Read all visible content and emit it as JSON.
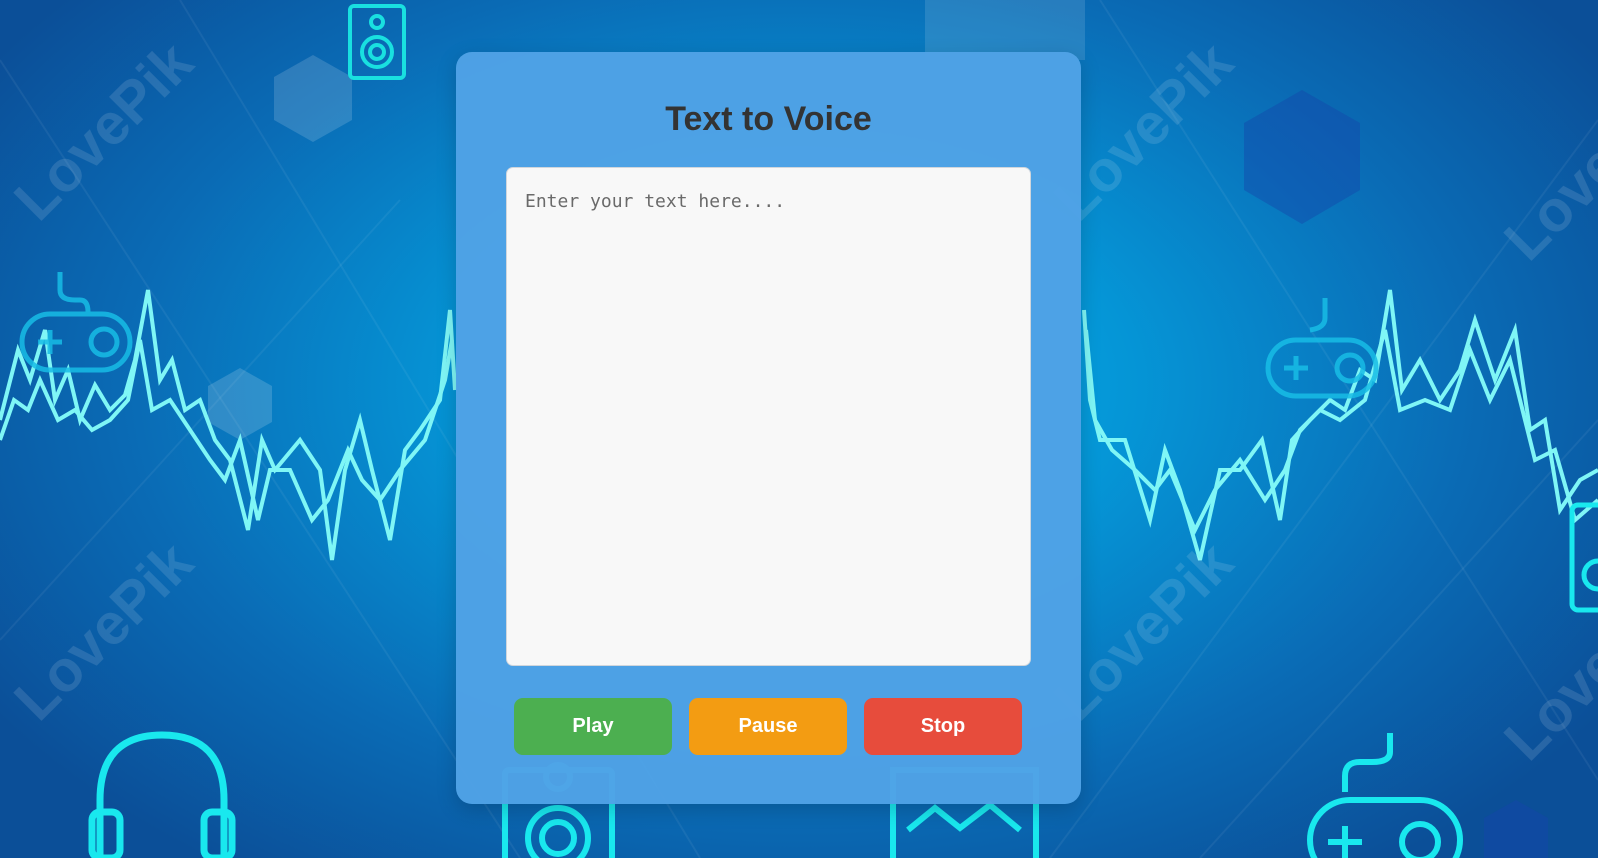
{
  "app": {
    "title": "Text to Voice"
  },
  "editor": {
    "value": "",
    "placeholder": "Enter your text here...."
  },
  "controls": {
    "play_label": "Play",
    "pause_label": "Pause",
    "stop_label": "Stop"
  },
  "background": {
    "watermark_text": "LovePik",
    "watermark_url": "lovepik.com",
    "icons": [
      "speaker-icon",
      "gamepad-icon",
      "headphones-icon",
      "camera-icon",
      "hexagon-shape",
      "sound-wave"
    ]
  },
  "colors": {
    "play": "#4caf50",
    "pause": "#f39c12",
    "stop": "#e74c3c",
    "card": "#50a2e6",
    "title": "#333333"
  }
}
